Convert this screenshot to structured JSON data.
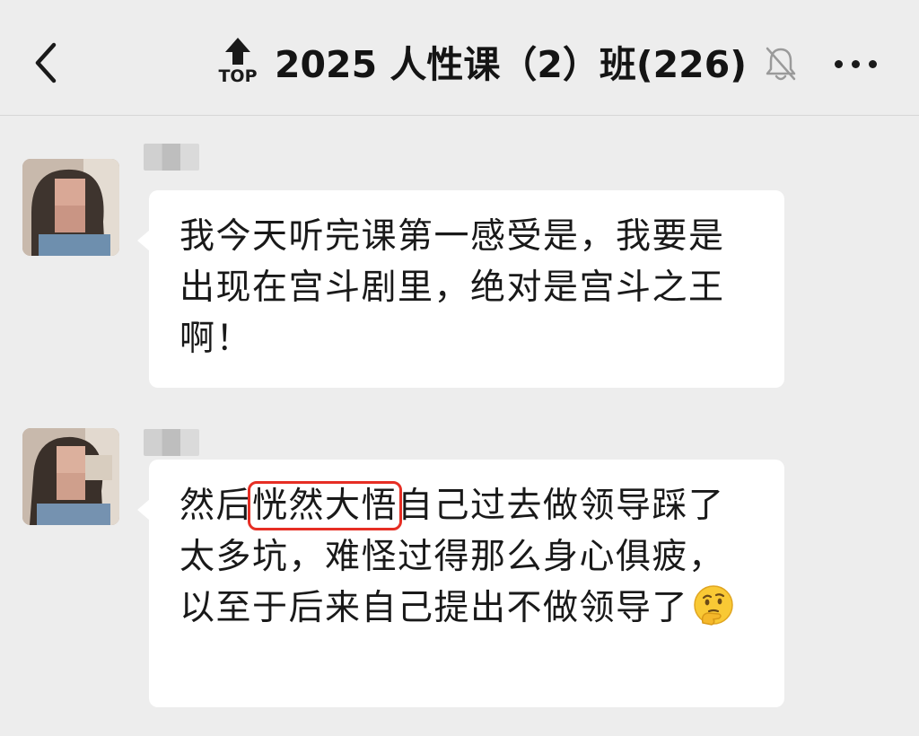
{
  "header": {
    "back_icon": "chevron-left-icon",
    "pin_badge": "TOP",
    "title": "2025 人性课（2）班(226)",
    "mute_icon": "bell-muted-icon",
    "more_icon": "more-dots-icon"
  },
  "messages": [
    {
      "sender_name": "",
      "text": "我今天听完课第一感受是，我要是出现在宫斗剧里，绝对是宫斗之王啊！"
    },
    {
      "sender_name": "",
      "text_before": "然后",
      "highlighted": "恍然大悟",
      "text_after": "自己过去做领导踩了太多坑，难怪过得那么身心俱疲，以至于后来自己提出不做领导了",
      "emoji": "thinking-face-emoji"
    }
  ],
  "colors": {
    "background": "#ededed",
    "bubble": "#ffffff",
    "highlight_border": "#e62e24",
    "text": "#191919"
  }
}
